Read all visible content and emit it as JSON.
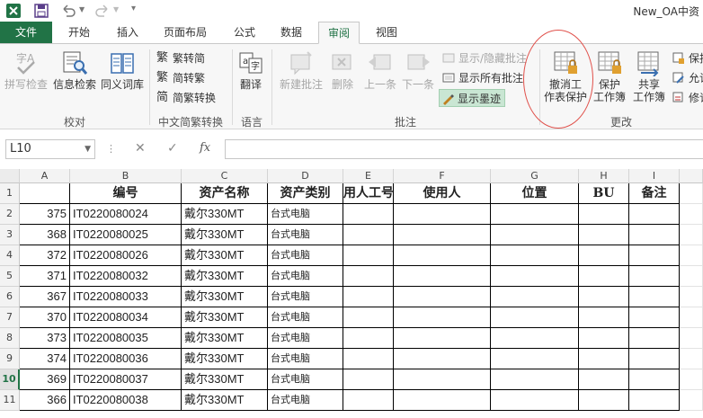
{
  "window": {
    "title": "New_OA中资"
  },
  "tabs": [
    "文件",
    "开始",
    "插入",
    "页面布局",
    "公式",
    "数据",
    "审阅",
    "视图"
  ],
  "ribbon": {
    "proofing": {
      "spell": "拼写检查",
      "research": "信息检索",
      "thesaurus": "同义词库",
      "group": "校对"
    },
    "chinese": {
      "to_simplified": "繁转简",
      "to_traditional": "简转繁",
      "convert": "简繁转换",
      "group": "中文简繁转换"
    },
    "language": {
      "translate": "翻译",
      "group": "语言"
    },
    "comments": {
      "new": "新建批注",
      "delete": "删除",
      "prev": "上一条",
      "next": "下一条",
      "show_hide": "显示/隐藏批注",
      "show_all": "显示所有批注",
      "show_ink": "显示墨迹",
      "group": "批注"
    },
    "changes": {
      "unprotect_l1": "撤消工",
      "unprotect_l2": "作表保护",
      "protect_l1": "保护",
      "protect_l2": "工作簿",
      "share_l1": "共享",
      "share_l2": "工作簿",
      "protect_share": "保护",
      "allow": "允许",
      "track": "修订",
      "group": "更改"
    }
  },
  "formula_bar": {
    "name_box": "L10",
    "fx": "fx",
    "value": ""
  },
  "columns": [
    "A",
    "B",
    "C",
    "D",
    "E",
    "F",
    "G",
    "H",
    "I"
  ],
  "headers": [
    "编号",
    "资产名称",
    "资产类别",
    "用人工号",
    "使用人",
    "位置",
    "BU",
    "备注"
  ],
  "rows": [
    {
      "row": "1"
    },
    {
      "row": "2",
      "a": "375",
      "id": "IT0220080024",
      "name": "戴尔330MT",
      "cat": "台式电脑"
    },
    {
      "row": "3",
      "a": "368",
      "id": "IT0220080025",
      "name": "戴尔330MT",
      "cat": "台式电脑"
    },
    {
      "row": "4",
      "a": "372",
      "id": "IT0220080026",
      "name": "戴尔330MT",
      "cat": "台式电脑"
    },
    {
      "row": "5",
      "a": "371",
      "id": "IT0220080032",
      "name": "戴尔330MT",
      "cat": "台式电脑"
    },
    {
      "row": "6",
      "a": "367",
      "id": "IT0220080033",
      "name": "戴尔330MT",
      "cat": "台式电脑"
    },
    {
      "row": "7",
      "a": "370",
      "id": "IT0220080034",
      "name": "戴尔330MT",
      "cat": "台式电脑"
    },
    {
      "row": "8",
      "a": "373",
      "id": "IT0220080035",
      "name": "戴尔330MT",
      "cat": "台式电脑"
    },
    {
      "row": "9",
      "a": "374",
      "id": "IT0220080036",
      "name": "戴尔330MT",
      "cat": "台式电脑"
    },
    {
      "row": "10",
      "a": "369",
      "id": "IT0220080037",
      "name": "戴尔330MT",
      "cat": "台式电脑"
    },
    {
      "row": "11",
      "a": "366",
      "id": "IT0220080038",
      "name": "戴尔330MT",
      "cat": "台式电脑"
    }
  ],
  "colors": {
    "accent": "#217346",
    "annotation": "#e0504a"
  }
}
